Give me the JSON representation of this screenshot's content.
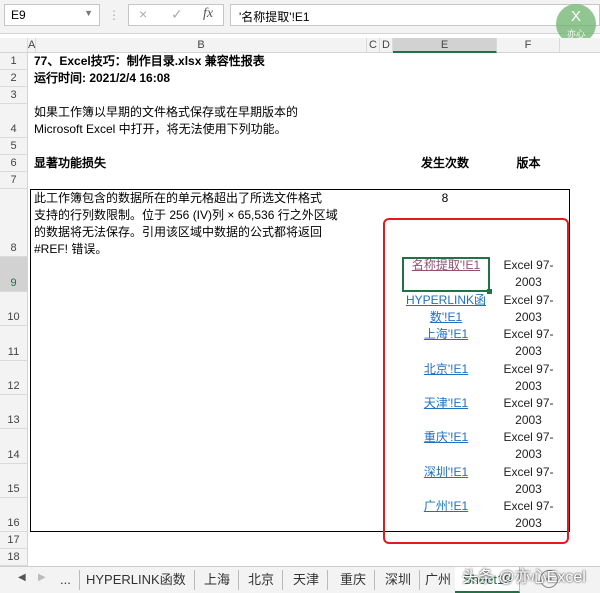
{
  "formula_bar": {
    "name_box": "E9",
    "cancel_icon": "×",
    "enter_icon": "✓",
    "fx_label": "fx",
    "formula": "'名称提取'!E1"
  },
  "logo": {
    "text": "亦心",
    "mark": "X"
  },
  "columns": [
    "A",
    "B",
    "C",
    "D",
    "E",
    "F"
  ],
  "rows": [
    "1",
    "2",
    "3",
    "4",
    "5",
    "6",
    "7",
    "8",
    "9",
    "10",
    "11",
    "12",
    "13",
    "14",
    "15",
    "16",
    "17",
    "18"
  ],
  "report": {
    "title": "77、Excel技巧：制作目录.xlsx 兼容性报表",
    "runtime": "运行时间: 2021/2/4 16:08",
    "intro_line1": "如果工作簿以早期的文件格式保存或在早期版本的",
    "intro_line2": "Microsoft Excel 中打开，将无法使用下列功能。",
    "section": "显著功能损失",
    "col_count": "发生次数",
    "col_version": "版本",
    "issue_lines": [
      "此工作簿包含的数据所在的单元格超出了所选文件格式",
      "支持的行列数限制。位于 256 (IV)列 × 65,536 行之外区域",
      "的数据将无法保存。引用该区域中数据的公式都将返回",
      "#REF! 错误。"
    ],
    "count": "8",
    "links": [
      {
        "line1": "名称提取'!E1",
        "line2": ""
      },
      {
        "line1": "HYPERLINK函",
        "line2": "数'!E1"
      },
      {
        "line1": "上海'!E1",
        "line2": ""
      },
      {
        "line1": "北京'!E1",
        "line2": ""
      },
      {
        "line1": "天津'!E1",
        "line2": ""
      },
      {
        "line1": "重庆'!E1",
        "line2": ""
      },
      {
        "line1": "深圳'!E1",
        "line2": ""
      },
      {
        "line1": "广州'!E1",
        "line2": ""
      }
    ],
    "version_line1": "Excel 97-",
    "version_line2": "2003"
  },
  "tabs": {
    "more": "...",
    "items": [
      "HYPERLINK函数",
      "上海",
      "北京",
      "天津",
      "重庆",
      "深圳",
      "广州"
    ],
    "active": "Sheet19",
    "add": "+"
  },
  "watermark": "头条 @亦心Excel",
  "colors": {
    "highlight": "#e8191b",
    "selection": "#217346",
    "link": "#1f6fc4",
    "visited": "#954f72"
  }
}
